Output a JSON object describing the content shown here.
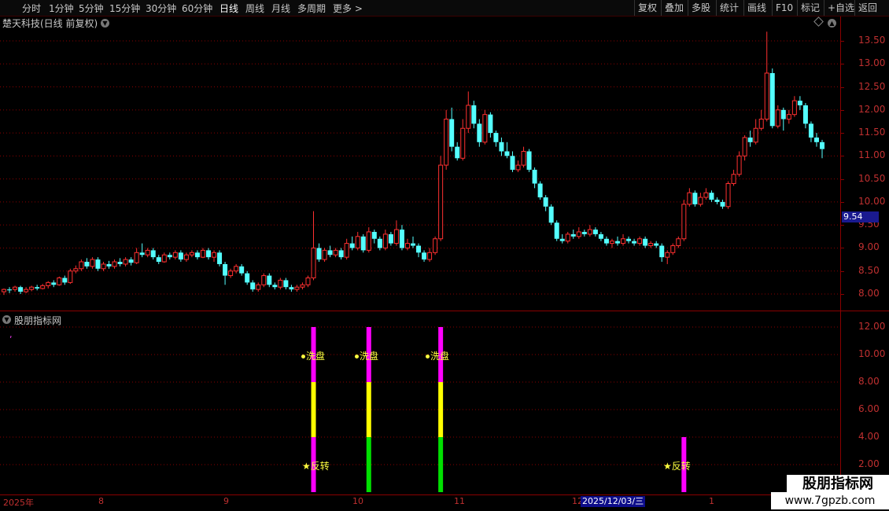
{
  "toolbar": {
    "left": [
      "分时",
      "1分钟",
      "5分钟",
      "15分钟",
      "30分钟",
      "60分钟",
      "日线",
      "周线",
      "月线",
      "多周期",
      "更多 >"
    ],
    "right": [
      "复权",
      "叠加",
      "多股",
      "统计",
      "画线",
      "F10",
      "标记",
      "+自选",
      "返回"
    ]
  },
  "stock_title": "楚天科技(日线 前复权)",
  "indicator_panel_name": "股朋指标网",
  "price_axis": [
    "13.50",
    "13.00",
    "12.50",
    "12.00",
    "11.50",
    "11.00",
    "10.50",
    "10.00",
    "9.50",
    "9.00",
    "8.50",
    "8.00"
  ],
  "last_price_tag": "9.54",
  "indicator_axis": [
    "12.00",
    "10.00",
    "8.00",
    "6.00",
    "4.00",
    "2.00"
  ],
  "date_axis": [
    "2025年",
    "8",
    "9",
    "10",
    "11",
    "12",
    "1"
  ],
  "crosshair_date": "2025/12/03/三",
  "signals": {
    "washout": "洗盘",
    "reversal": "反转"
  },
  "watermark": {
    "title": "股朋指标网",
    "url": "www.7gpzb.com"
  },
  "colors": {
    "up": "#ff3030",
    "down": "#54ffff",
    "magenta": "#ff00ff",
    "yellow": "#ffff00",
    "green": "#00e000",
    "grid": "#8a0000"
  },
  "chart_data": {
    "type": "candlestick",
    "ylim": [
      7.8,
      13.8
    ],
    "candles": [
      [
        8.05,
        8.1,
        7.98,
        8.12
      ],
      [
        8.1,
        8.08,
        8.02,
        8.15
      ],
      [
        8.1,
        8.15,
        8.05,
        8.18
      ],
      [
        8.15,
        8.05,
        8.0,
        8.18
      ],
      [
        8.05,
        8.1,
        8.02,
        8.15
      ],
      [
        8.1,
        8.15,
        8.06,
        8.18
      ],
      [
        8.15,
        8.12,
        8.08,
        8.2
      ],
      [
        8.12,
        8.18,
        8.1,
        8.22
      ],
      [
        8.18,
        8.25,
        8.12,
        8.28
      ],
      [
        8.25,
        8.2,
        8.15,
        8.3
      ],
      [
        8.2,
        8.35,
        8.18,
        8.38
      ],
      [
        8.35,
        8.25,
        8.2,
        8.4
      ],
      [
        8.25,
        8.5,
        8.22,
        8.55
      ],
      [
        8.5,
        8.55,
        8.45,
        8.62
      ],
      [
        8.55,
        8.7,
        8.5,
        8.75
      ],
      [
        8.7,
        8.6,
        8.55,
        8.78
      ],
      [
        8.6,
        8.75,
        8.55,
        8.8
      ],
      [
        8.75,
        8.55,
        8.5,
        8.8
      ],
      [
        8.55,
        8.65,
        8.5,
        8.7
      ],
      [
        8.65,
        8.6,
        8.55,
        8.72
      ],
      [
        8.6,
        8.7,
        8.55,
        8.75
      ],
      [
        8.7,
        8.65,
        8.6,
        8.78
      ],
      [
        8.65,
        8.75,
        8.6,
        8.8
      ],
      [
        8.75,
        8.68,
        8.62,
        8.8
      ],
      [
        8.68,
        8.9,
        8.65,
        9.0
      ],
      [
        8.9,
        8.85,
        8.8,
        9.1
      ],
      [
        8.85,
        8.95,
        8.8,
        9.0
      ],
      [
        8.95,
        8.8,
        8.75,
        9.0
      ],
      [
        8.8,
        8.7,
        8.65,
        8.85
      ],
      [
        8.7,
        8.85,
        8.68,
        8.9
      ],
      [
        8.85,
        8.8,
        8.75,
        8.9
      ],
      [
        8.8,
        8.9,
        8.75,
        8.95
      ],
      [
        8.9,
        8.75,
        8.7,
        8.95
      ],
      [
        8.75,
        8.85,
        8.7,
        8.9
      ],
      [
        8.85,
        8.9,
        8.8,
        8.95
      ],
      [
        8.9,
        8.8,
        8.75,
        8.95
      ],
      [
        8.8,
        8.95,
        8.78,
        9.0
      ],
      [
        8.95,
        8.8,
        8.75,
        9.0
      ],
      [
        8.8,
        8.9,
        8.7,
        8.95
      ],
      [
        8.9,
        8.65,
        8.6,
        8.95
      ],
      [
        8.65,
        8.4,
        8.2,
        8.7
      ],
      [
        8.4,
        8.5,
        8.35,
        8.55
      ],
      [
        8.5,
        8.6,
        8.45,
        8.65
      ],
      [
        8.6,
        8.45,
        8.4,
        8.65
      ],
      [
        8.45,
        8.25,
        8.2,
        8.5
      ],
      [
        8.25,
        8.1,
        8.05,
        8.3
      ],
      [
        8.1,
        8.2,
        8.05,
        8.25
      ],
      [
        8.2,
        8.4,
        8.15,
        8.45
      ],
      [
        8.4,
        8.2,
        8.15,
        8.45
      ],
      [
        8.2,
        8.15,
        8.1,
        8.25
      ],
      [
        8.15,
        8.3,
        8.1,
        8.35
      ],
      [
        8.3,
        8.15,
        8.1,
        8.35
      ],
      [
        8.15,
        8.1,
        8.05,
        8.2
      ],
      [
        8.1,
        8.15,
        8.05,
        8.2
      ],
      [
        8.15,
        8.2,
        8.1,
        8.25
      ],
      [
        8.2,
        8.35,
        8.15,
        8.4
      ],
      [
        8.35,
        9.0,
        8.3,
        9.8
      ],
      [
        9.0,
        8.75,
        8.7,
        9.1
      ],
      [
        8.75,
        8.95,
        8.7,
        9.0
      ],
      [
        8.95,
        8.85,
        8.8,
        9.05
      ],
      [
        8.85,
        8.95,
        8.8,
        9.0
      ],
      [
        8.95,
        8.8,
        8.75,
        9.0
      ],
      [
        8.8,
        9.1,
        8.75,
        9.2
      ],
      [
        9.1,
        9.0,
        8.95,
        9.25
      ],
      [
        9.0,
        9.25,
        8.95,
        9.35
      ],
      [
        9.25,
        8.95,
        8.9,
        9.3
      ],
      [
        8.95,
        9.35,
        8.9,
        9.45
      ],
      [
        9.35,
        9.2,
        9.1,
        9.4
      ],
      [
        9.2,
        9.0,
        8.95,
        9.25
      ],
      [
        9.0,
        9.3,
        8.95,
        9.4
      ],
      [
        9.3,
        9.1,
        9.05,
        9.35
      ],
      [
        9.1,
        9.4,
        9.05,
        9.6
      ],
      [
        9.4,
        9.0,
        8.95,
        9.5
      ],
      [
        9.0,
        9.1,
        8.95,
        9.2
      ],
      [
        9.1,
        9.05,
        9.0,
        9.25
      ],
      [
        9.05,
        8.9,
        8.8,
        9.1
      ],
      [
        8.9,
        8.75,
        8.7,
        8.95
      ],
      [
        8.75,
        8.9,
        8.7,
        9.0
      ],
      [
        8.9,
        9.2,
        8.85,
        9.25
      ],
      [
        9.2,
        10.8,
        9.15,
        11.0
      ],
      [
        10.8,
        11.8,
        10.7,
        12.0
      ],
      [
        11.8,
        11.2,
        11.1,
        12.05
      ],
      [
        11.2,
        10.95,
        10.9,
        11.3
      ],
      [
        10.95,
        11.6,
        10.9,
        11.8
      ],
      [
        11.6,
        12.1,
        11.5,
        12.4
      ],
      [
        12.1,
        11.7,
        11.6,
        12.2
      ],
      [
        11.7,
        11.3,
        11.2,
        11.8
      ],
      [
        11.3,
        11.9,
        11.25,
        12.0
      ],
      [
        11.9,
        11.5,
        11.4,
        11.95
      ],
      [
        11.5,
        11.3,
        11.2,
        11.55
      ],
      [
        11.3,
        11.1,
        11.0,
        11.4
      ],
      [
        11.1,
        11.0,
        10.95,
        11.3
      ],
      [
        11.0,
        10.7,
        10.65,
        11.1
      ],
      [
        10.7,
        10.8,
        10.65,
        10.9
      ],
      [
        10.8,
        11.1,
        10.75,
        11.2
      ],
      [
        11.1,
        10.7,
        10.65,
        11.15
      ],
      [
        10.7,
        10.4,
        10.3,
        10.75
      ],
      [
        10.4,
        10.1,
        10.05,
        10.45
      ],
      [
        10.1,
        9.9,
        9.8,
        10.15
      ],
      [
        9.9,
        9.55,
        9.5,
        9.95
      ],
      [
        9.55,
        9.2,
        9.15,
        9.6
      ],
      [
        9.2,
        9.15,
        9.1,
        9.3
      ],
      [
        9.15,
        9.3,
        9.1,
        9.35
      ],
      [
        9.3,
        9.25,
        9.2,
        9.4
      ],
      [
        9.25,
        9.35,
        9.2,
        9.45
      ],
      [
        9.35,
        9.3,
        9.25,
        9.4
      ],
      [
        9.3,
        9.4,
        9.25,
        9.5
      ],
      [
        9.4,
        9.3,
        9.25,
        9.45
      ],
      [
        9.3,
        9.2,
        9.15,
        9.35
      ],
      [
        9.2,
        9.1,
        9.05,
        9.25
      ],
      [
        9.1,
        9.15,
        9.0,
        9.2
      ],
      [
        9.15,
        9.1,
        9.05,
        9.25
      ],
      [
        9.1,
        9.2,
        9.05,
        9.3
      ],
      [
        9.2,
        9.15,
        9.1,
        9.25
      ],
      [
        9.15,
        9.1,
        9.05,
        9.2
      ],
      [
        9.1,
        9.2,
        9.05,
        9.25
      ],
      [
        9.2,
        9.05,
        9.0,
        9.25
      ],
      [
        9.05,
        9.1,
        9.0,
        9.15
      ],
      [
        9.1,
        9.05,
        9.0,
        9.15
      ],
      [
        9.05,
        8.8,
        8.7,
        9.1
      ],
      [
        8.8,
        8.9,
        8.65,
        8.95
      ],
      [
        8.9,
        9.05,
        8.85,
        9.1
      ],
      [
        9.05,
        9.2,
        9.0,
        9.25
      ],
      [
        9.2,
        9.95,
        9.15,
        10.05
      ],
      [
        9.95,
        10.2,
        9.9,
        10.3
      ],
      [
        10.2,
        9.95,
        9.9,
        10.25
      ],
      [
        9.95,
        10.1,
        9.9,
        10.2
      ],
      [
        10.1,
        10.2,
        10.05,
        10.3
      ],
      [
        10.2,
        10.05,
        10.0,
        10.25
      ],
      [
        10.05,
        10.0,
        9.95,
        10.1
      ],
      [
        10.0,
        9.9,
        9.85,
        10.05
      ],
      [
        9.9,
        10.4,
        9.85,
        10.45
      ],
      [
        10.4,
        10.6,
        10.35,
        10.7
      ],
      [
        10.6,
        11.0,
        10.55,
        11.1
      ],
      [
        11.0,
        11.4,
        10.9,
        11.45
      ],
      [
        11.4,
        11.3,
        11.2,
        11.55
      ],
      [
        11.3,
        11.6,
        11.25,
        11.8
      ],
      [
        11.6,
        11.8,
        11.55,
        12.0
      ],
      [
        11.8,
        12.8,
        11.75,
        13.7
      ],
      [
        12.8,
        11.65,
        11.6,
        12.9
      ],
      [
        11.65,
        12.0,
        11.6,
        12.1
      ],
      [
        12.0,
        11.8,
        11.55,
        12.05
      ],
      [
        11.8,
        11.9,
        11.7,
        12.0
      ],
      [
        11.9,
        12.2,
        11.85,
        12.3
      ],
      [
        12.2,
        12.1,
        12.0,
        12.3
      ],
      [
        12.1,
        11.7,
        11.6,
        12.15
      ],
      [
        11.7,
        11.4,
        11.3,
        11.75
      ],
      [
        11.4,
        11.3,
        11.2,
        11.5
      ],
      [
        11.3,
        11.15,
        10.95,
        11.35
      ]
    ],
    "indicator": {
      "ylim": [
        0,
        13
      ],
      "signal_bars": [
        {
          "index": 56,
          "segments": [
            [
              0,
              4,
              "magenta"
            ],
            [
              4,
              8,
              "yellow"
            ],
            [
              8,
              12,
              "magenta"
            ]
          ]
        },
        {
          "index": 66,
          "segments": [
            [
              0,
              4,
              "green"
            ],
            [
              4,
              8,
              "yellow"
            ],
            [
              8,
              12,
              "magenta"
            ]
          ]
        },
        {
          "index": 79,
          "segments": [
            [
              0,
              4,
              "green"
            ],
            [
              4,
              8,
              "yellow"
            ],
            [
              8,
              12,
              "magenta"
            ]
          ]
        },
        {
          "index": 123,
          "segments": [
            [
              0,
              4,
              "magenta"
            ]
          ]
        }
      ]
    }
  }
}
